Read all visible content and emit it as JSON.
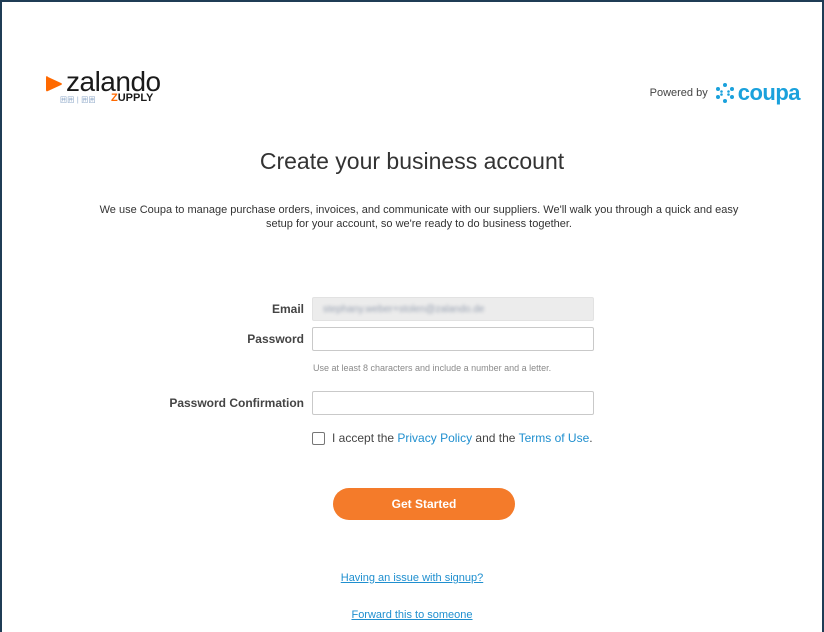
{
  "brand": {
    "logo_word": "zalando",
    "logo_sub_small": "囲囲 | 囲囲",
    "logo_sub_z": "Z",
    "logo_sub_rest": "UPPLY",
    "powered_by": "Powered by",
    "coupa_word": "coupa"
  },
  "main": {
    "title": "Create your business account",
    "description": "We use Coupa to manage purchase orders, invoices, and communicate with our suppliers. We'll walk you through a quick and easy setup for your account, so we're ready to do business together."
  },
  "form": {
    "email_label": "Email",
    "email_value": "stephany.weber+stolen@zalando.de",
    "password_label": "Password",
    "password_hint": "Use at least 8 characters and include a number and a letter.",
    "password_confirm_label": "Password Confirmation",
    "accept_prefix": "I accept the",
    "privacy_policy": "Privacy Policy",
    "and_the": "and the",
    "terms_of_use": "Terms of Use",
    "period": ".",
    "submit_label": "Get Started"
  },
  "footer": {
    "issue_link": "Having an issue with signup?",
    "forward_link": "Forward this to someone"
  },
  "colors": {
    "accent_orange": "#f47b2a",
    "link_blue": "#1f8fcf",
    "coupa_blue": "#1aa1dc",
    "zalando_orange": "#ff6900"
  }
}
